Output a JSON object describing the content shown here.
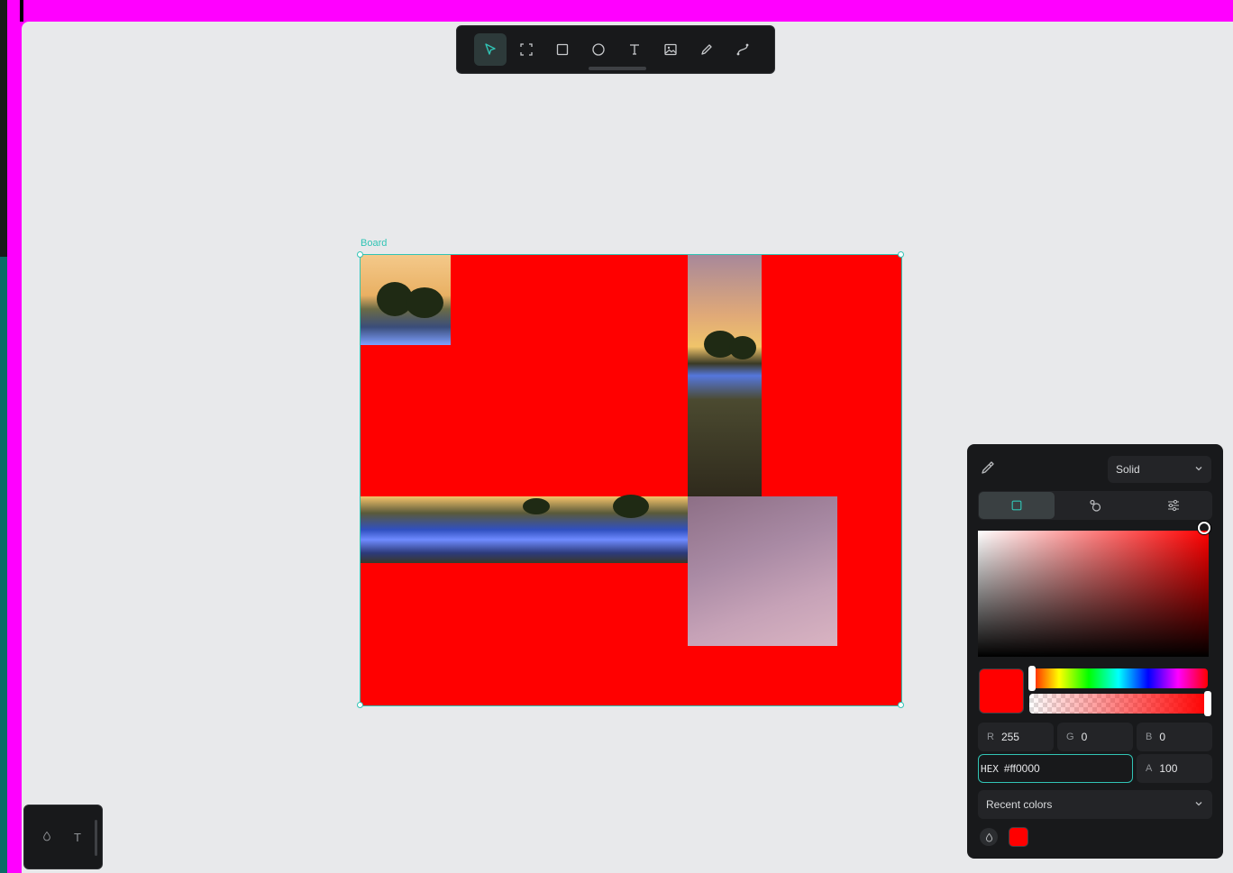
{
  "colors": {
    "accent": "#31c4b5",
    "panel_bg": "#18191b",
    "canvas_bg": "#e8e9eb",
    "board_fill": "#ff0000",
    "outer_bg": "#ff00ff"
  },
  "toolbar": {
    "tools": [
      {
        "name": "move-tool",
        "icon": "pointer-arrow-icon",
        "active": true
      },
      {
        "name": "board-tool",
        "icon": "frame-icon",
        "active": false
      },
      {
        "name": "rectangle-tool",
        "icon": "square-icon",
        "active": false
      },
      {
        "name": "ellipse-tool",
        "icon": "circle-icon",
        "active": false
      },
      {
        "name": "text-tool",
        "icon": "text-T-icon",
        "active": false
      },
      {
        "name": "image-tool",
        "icon": "image-icon",
        "active": false
      },
      {
        "name": "pencil-tool",
        "icon": "pencil-icon",
        "active": false
      },
      {
        "name": "path-tool",
        "icon": "curve-path-icon",
        "active": false
      }
    ]
  },
  "board": {
    "label": "Board",
    "images": [
      "sunset-trees",
      "sunset-path-vertical",
      "glowing-field-horizontal",
      "star-trails-sky"
    ]
  },
  "bottom_panel": {
    "icons": [
      "drop-icon",
      "text-icon"
    ],
    "text_glyph": "T"
  },
  "color_picker": {
    "mode": "Solid",
    "tabs": [
      "square-swatch-icon",
      "libraries-icon",
      "sliders-icon"
    ],
    "hue_position": 0,
    "alpha_position": 1,
    "saturation": 1,
    "value": 1,
    "r_label": "R",
    "r_value": "255",
    "g_label": "G",
    "g_value": "0",
    "b_label": "B",
    "b_value": "0",
    "hex_label": "HEX",
    "hex_value": "#ff0000",
    "a_label": "A",
    "a_value": "100",
    "recent_label": "Recent colors",
    "recent_colors": [
      "#ff0000"
    ]
  }
}
